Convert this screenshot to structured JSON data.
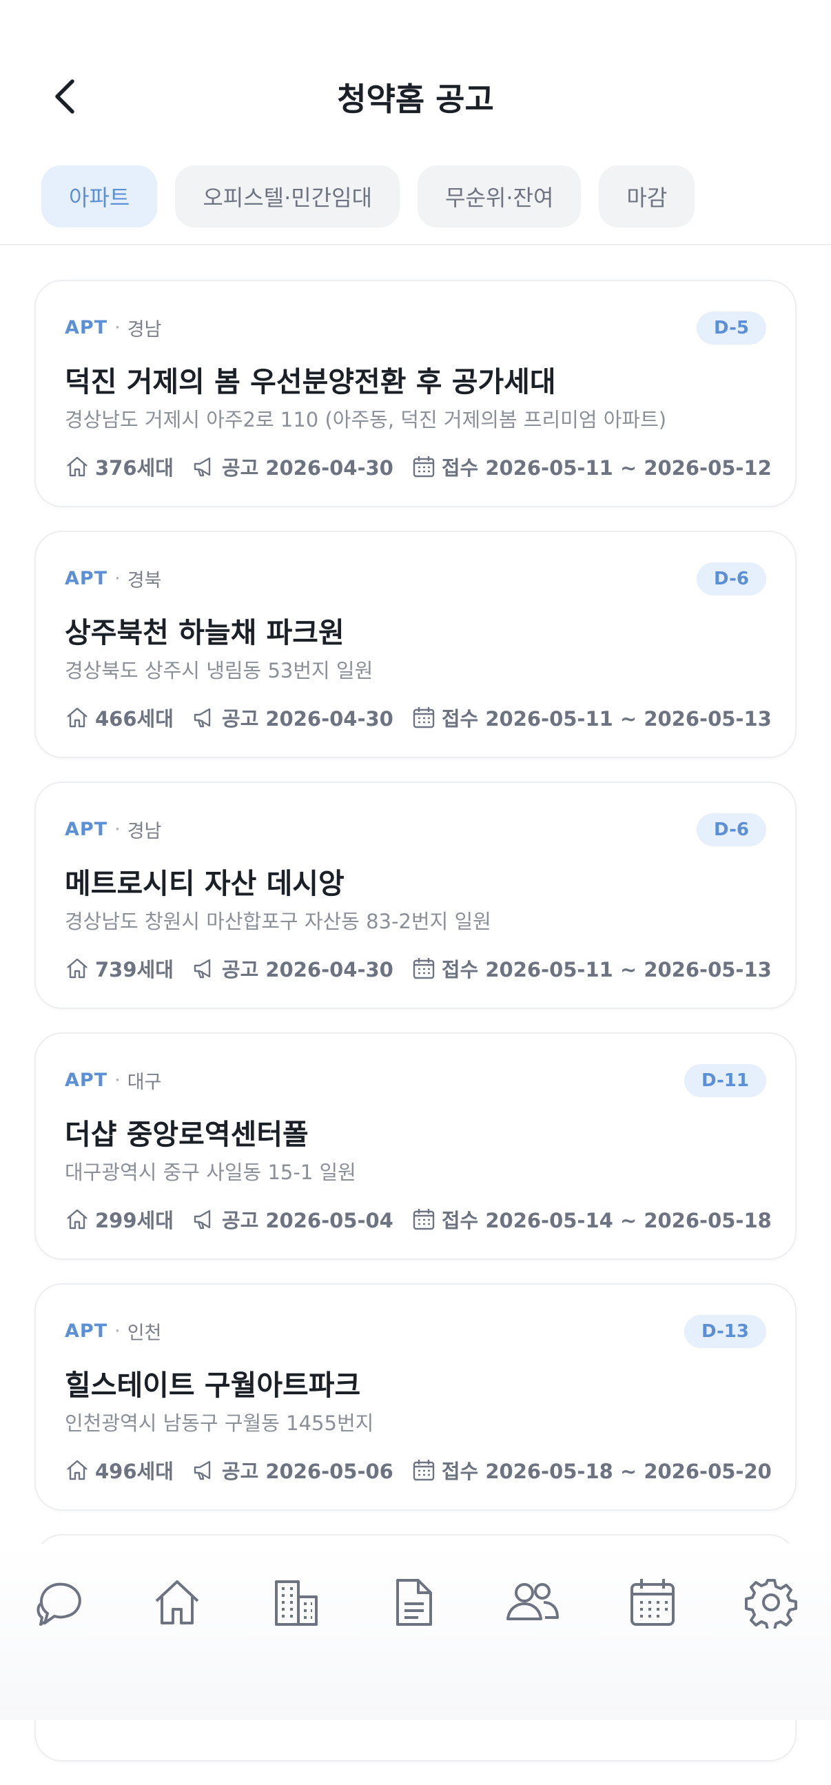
{
  "header": {
    "title": "청약홈 공고"
  },
  "tabs": [
    {
      "label": "아파트",
      "active": true
    },
    {
      "label": "오피스텔·민간임대",
      "active": false
    },
    {
      "label": "무순위·잔여",
      "active": false
    },
    {
      "label": "마감",
      "active": false
    }
  ],
  "listings": [
    {
      "type": "APT",
      "region": "경남",
      "dday": "D-5",
      "name": "덕진 거제의 봄 우선분양전환 후 공가세대",
      "address": "경상남도 거제시 아주2로 110 (아주동, 덕진 거제의봄 프리미엄 아파트)",
      "households": "376세대",
      "notice": "공고 2026-04-30",
      "apply": "접수 2026-05-11 ~ 2026-05-12"
    },
    {
      "type": "APT",
      "region": "경북",
      "dday": "D-6",
      "name": "상주북천 하늘채 파크원",
      "address": "경상북도 상주시 냉림동 53번지 일원",
      "households": "466세대",
      "notice": "공고 2026-04-30",
      "apply": "접수 2026-05-11 ~ 2026-05-13"
    },
    {
      "type": "APT",
      "region": "경남",
      "dday": "D-6",
      "name": "메트로시티 자산 데시앙",
      "address": "경상남도 창원시 마산합포구 자산동 83-2번지 일원",
      "households": "739세대",
      "notice": "공고 2026-04-30",
      "apply": "접수 2026-05-11 ~ 2026-05-13"
    },
    {
      "type": "APT",
      "region": "대구",
      "dday": "D-11",
      "name": "더샵 중앙로역센터폴",
      "address": "대구광역시 중구 사일동 15-1 일원",
      "households": "299세대",
      "notice": "공고 2026-05-04",
      "apply": "접수 2026-05-14 ~ 2026-05-18"
    },
    {
      "type": "APT",
      "region": "인천",
      "dday": "D-13",
      "name": "힐스테이트 구월아트파크",
      "address": "인천광역시 남동구 구월동 1455번지",
      "households": "496세대",
      "notice": "공고 2026-05-06",
      "apply": "접수 2026-05-18 ~ 2026-05-20"
    }
  ],
  "bottom_nav": [
    {
      "icon": "chat-icon"
    },
    {
      "icon": "home-icon"
    },
    {
      "icon": "building-icon"
    },
    {
      "icon": "document-icon"
    },
    {
      "icon": "users-icon"
    },
    {
      "icon": "calendar-icon"
    },
    {
      "icon": "gear-icon"
    }
  ],
  "colors": {
    "accent": "#5b8fd6",
    "accent_bg": "#e6effc",
    "text": "#1b1f26",
    "muted": "#8a8f98"
  }
}
